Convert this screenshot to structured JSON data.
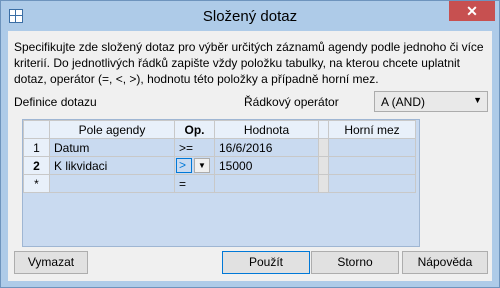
{
  "window": {
    "title": "Složený dotaz",
    "close_glyph": "✕"
  },
  "description": "Specifikujte zde složený dotaz pro výběr určitých záznamů agendy podle jednoho či více kriterií. Do jednotlivých řádků zapište vždy položku tabulky, na kterou chcete uplatnit dotaz, operátor (=, <, >), hodnotu této položky a případně horní mez.",
  "definition_label": "Definice dotazu",
  "operator": {
    "label": "Řádkový operátor",
    "value": "A (AND)"
  },
  "grid": {
    "columns": [
      "Pole agendy",
      "Op.",
      "Hodnota",
      "Horní mez"
    ],
    "rows": [
      {
        "num": "1",
        "field": "Datum",
        "op": ">=",
        "value": "16/6/2016",
        "upper": ""
      },
      {
        "num": "2",
        "field": "K likvidaci",
        "op": ">",
        "value": "15000",
        "upper": ""
      },
      {
        "num": "*",
        "field": "",
        "op": "=",
        "value": "",
        "upper": ""
      }
    ]
  },
  "buttons": {
    "clear": "Vymazat",
    "apply": "Použít",
    "cancel": "Storno",
    "help": "Nápověda"
  }
}
